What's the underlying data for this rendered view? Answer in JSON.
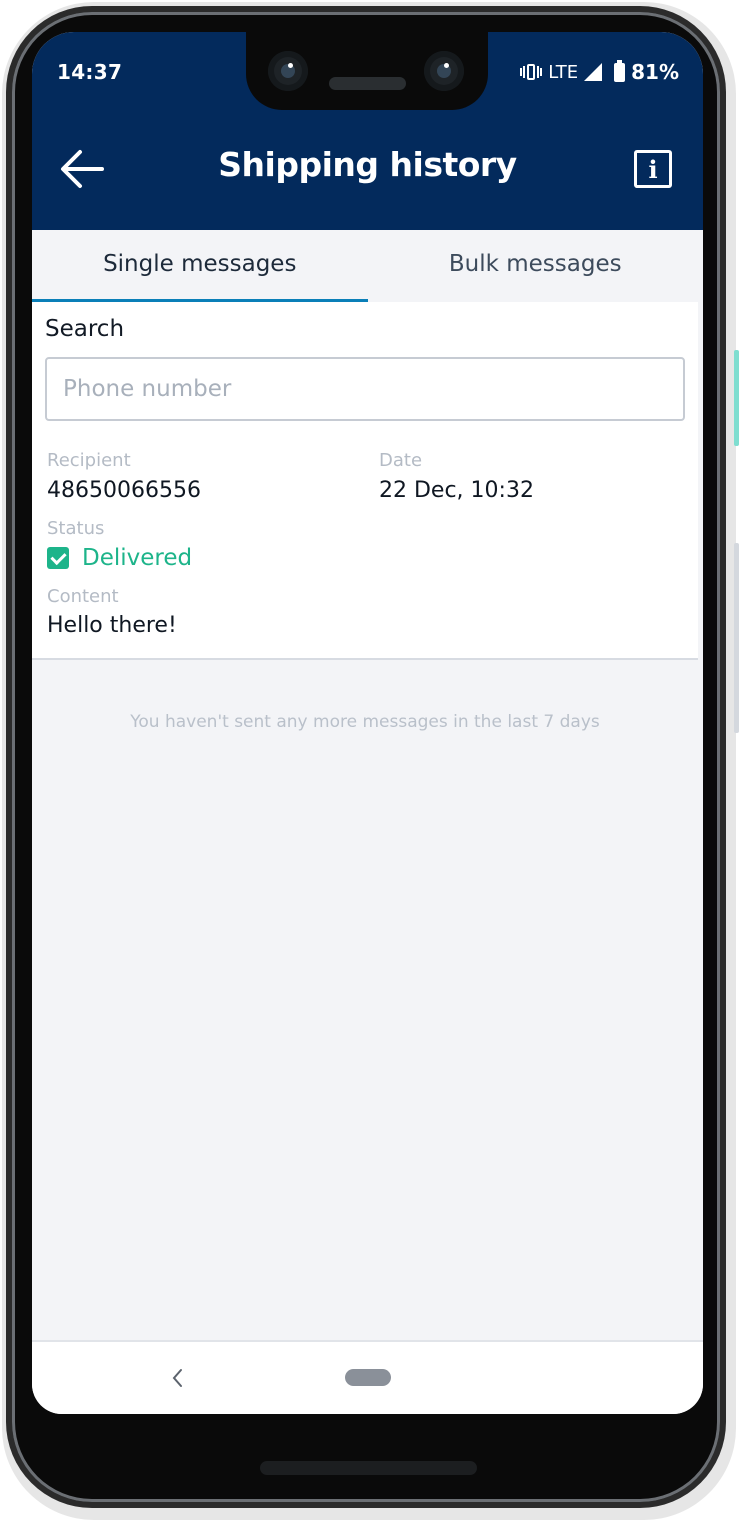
{
  "status_bar": {
    "time": "14:37",
    "network": "LTE",
    "battery": "81%",
    "icons": [
      "vibrate-icon",
      "signal-icon",
      "battery-icon"
    ]
  },
  "app_bar": {
    "title": "Shipping history",
    "back_icon": "arrow-left-icon",
    "info_icon": "info-icon",
    "info_glyph": "i"
  },
  "tabs": [
    {
      "label": "Single messages",
      "active": true
    },
    {
      "label": "Bulk messages",
      "active": false
    }
  ],
  "search": {
    "label": "Search",
    "placeholder": "Phone number",
    "value": ""
  },
  "messages": [
    {
      "recipient_label": "Recipient",
      "recipient": "48650066556",
      "date_label": "Date",
      "date": "22 Dec, 10:32",
      "status_label": "Status",
      "status": "Delivered",
      "content_label": "Content",
      "content": "Hello there!"
    }
  ],
  "empty_note": "You haven't sent any more messages in the last 7 days",
  "colors": {
    "app_bar": "#032a5c",
    "tab_indicator": "#0a7fb8",
    "status_delivered": "#1db48a",
    "background": "#f3f4f7"
  }
}
